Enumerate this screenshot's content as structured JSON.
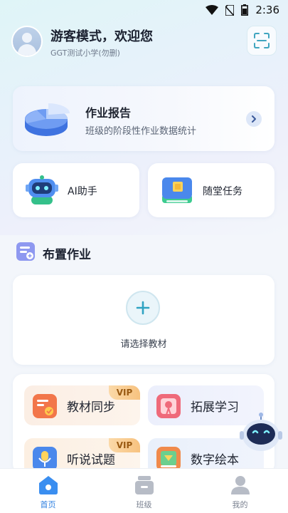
{
  "status_bar": {
    "time": "2:36",
    "icons": [
      "wifi-icon",
      "no-sim-icon",
      "battery-icon"
    ]
  },
  "header": {
    "greeting": "游客模式，欢迎您",
    "school": "GGT测试小学(勿删)",
    "scan_icon": "scan-icon"
  },
  "report": {
    "title": "作业报告",
    "subtitle": "班级的阶段性作业数据统计"
  },
  "quick_actions": [
    {
      "label": "AI助手",
      "icon": "robot-icon"
    },
    {
      "label": "随堂任务",
      "icon": "classroom-task-icon"
    }
  ],
  "assign_section": {
    "title": "布置作业",
    "choose_textbook": "请选择教材"
  },
  "features": [
    {
      "label": "教材同步",
      "badge": "VIP",
      "icon": "textbook-sync-icon"
    },
    {
      "label": "拓展学习",
      "badge": "",
      "icon": "extended-learning-icon"
    },
    {
      "label": "听说试题",
      "badge": "VIP",
      "icon": "listening-speaking-icon"
    },
    {
      "label": "数字绘本",
      "badge": "",
      "icon": "picture-book-icon"
    }
  ],
  "tabbar": [
    {
      "label": "首页",
      "active": true
    },
    {
      "label": "班级",
      "active": false
    },
    {
      "label": "我的",
      "active": false
    }
  ],
  "colors": {
    "accent": "#2d7fe0",
    "vip_bg": "#f7c27f",
    "vip_text": "#9a5a12"
  }
}
